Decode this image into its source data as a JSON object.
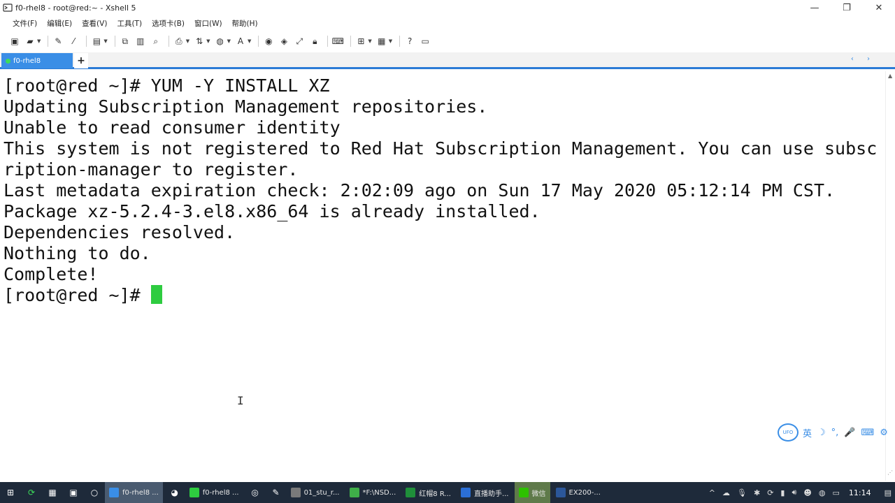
{
  "window": {
    "title": "f0-rhel8 - root@red:~ - Xshell 5",
    "controls": {
      "minimize": "—",
      "restore": "❐",
      "close": "✕"
    }
  },
  "menu": [
    {
      "label": "文件(F)"
    },
    {
      "label": "编辑(E)"
    },
    {
      "label": "查看(V)"
    },
    {
      "label": "工具(T)"
    },
    {
      "label": "选项卡(B)"
    },
    {
      "label": "窗口(W)"
    },
    {
      "label": "帮助(H)"
    }
  ],
  "tabs": {
    "active": "f0-rhel8",
    "add": "+",
    "nav": "‹ ›"
  },
  "terminal": {
    "lines": [
      "[root@red ~]# YUM -Y INSTALL XZ",
      "Updating Subscription Management repositories.",
      "Unable to read consumer identity",
      "This system is not registered to Red Hat Subscription Management. You can use subsc",
      "ription-manager to register.",
      "Last metadata expiration check: 2:02:09 ago on Sun 17 May 2020 05:12:14 PM CST.",
      "Package xz-5.2.4-3.el8.x86_64 is already installed.",
      "Dependencies resolved.",
      "Nothing to do.",
      "Complete!"
    ],
    "prompt": "[root@red ~]# ",
    "ibeam": "I"
  },
  "ime": {
    "logo": "UFO",
    "items": [
      "英",
      "☽",
      "°,",
      "🎤",
      "⌨",
      "⚙"
    ]
  },
  "taskbar": {
    "apps": [
      {
        "label": "f0-rhel8 ...",
        "color": "#3a8ee6",
        "state": "active"
      },
      {
        "label": "f0-rhel8 ...",
        "color": "#2ecc40",
        "state": "normal"
      },
      {
        "label": "01_stu_r...",
        "color": "#7a7a7a",
        "state": "normal"
      },
      {
        "label": "*F:\\NSD...",
        "color": "#3fae49",
        "state": "normal"
      },
      {
        "label": "红帽8 R...",
        "color": "#1f8f3a",
        "state": "normal"
      },
      {
        "label": "直播助手...",
        "color": "#2b6fd6",
        "state": "normal"
      },
      {
        "label": "微信",
        "color": "#2dc100",
        "state": "highlight"
      },
      {
        "label": "EX200-...",
        "color": "#2b579a",
        "state": "normal"
      }
    ],
    "clock": "11:14"
  }
}
